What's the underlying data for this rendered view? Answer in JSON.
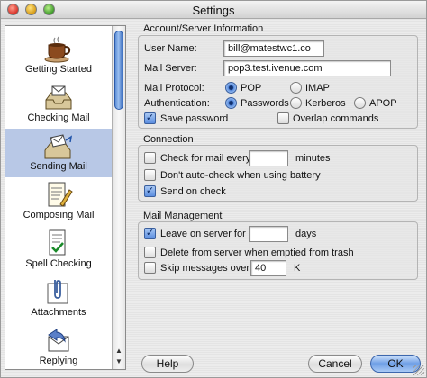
{
  "window": {
    "title": "Settings"
  },
  "sidebar": {
    "items": [
      {
        "label": "Getting Started",
        "icon": "coffee-cup-icon"
      },
      {
        "label": "Checking Mail",
        "icon": "inbox-tray-icon"
      },
      {
        "label": "Sending Mail",
        "icon": "outbox-envelope-icon",
        "selected": true
      },
      {
        "label": "Composing Mail",
        "icon": "document-pen-icon"
      },
      {
        "label": "Spell Checking",
        "icon": "spell-check-icon"
      },
      {
        "label": "Attachments",
        "icon": "attachment-clip-icon"
      },
      {
        "label": "Replying",
        "icon": "reply-envelope-icon"
      }
    ]
  },
  "account": {
    "section_title": "Account/Server Information",
    "user_name_label": "User Name:",
    "user_name_value": "bill@matestwc1.co",
    "mail_server_label": "Mail Server:",
    "mail_server_value": "pop3.test.ivenue.com",
    "protocol_label": "Mail Protocol:",
    "protocol_options": [
      "POP",
      "IMAP"
    ],
    "protocol_selected": "POP",
    "auth_label": "Authentication:",
    "auth_options": [
      "Passwords",
      "Kerberos",
      "APOP"
    ],
    "auth_selected": "Passwords",
    "save_password_label": "Save password",
    "save_password_checked": true,
    "overlap_label": "Overlap commands",
    "overlap_checked": false
  },
  "connection": {
    "section_title": "Connection",
    "check_every_label": "Check for mail every",
    "check_every_value": "",
    "check_every_unit": "minutes",
    "check_every_checked": false,
    "battery_label": "Don't auto-check when using battery",
    "battery_checked": false,
    "send_on_check_label": "Send on check",
    "send_on_check_checked": true
  },
  "management": {
    "section_title": "Mail Management",
    "leave_label": "Leave on server for",
    "leave_value": "",
    "leave_unit": "days",
    "leave_checked": true,
    "delete_label": "Delete from server when emptied from trash",
    "delete_checked": false,
    "skip_label": "Skip messages over",
    "skip_value": "40",
    "skip_unit": "K",
    "skip_checked": false
  },
  "buttons": {
    "help": "Help",
    "cancel": "Cancel",
    "ok": "OK"
  },
  "colors": {
    "selection": "#b8c8e6",
    "accent": "#5b8ee0"
  }
}
